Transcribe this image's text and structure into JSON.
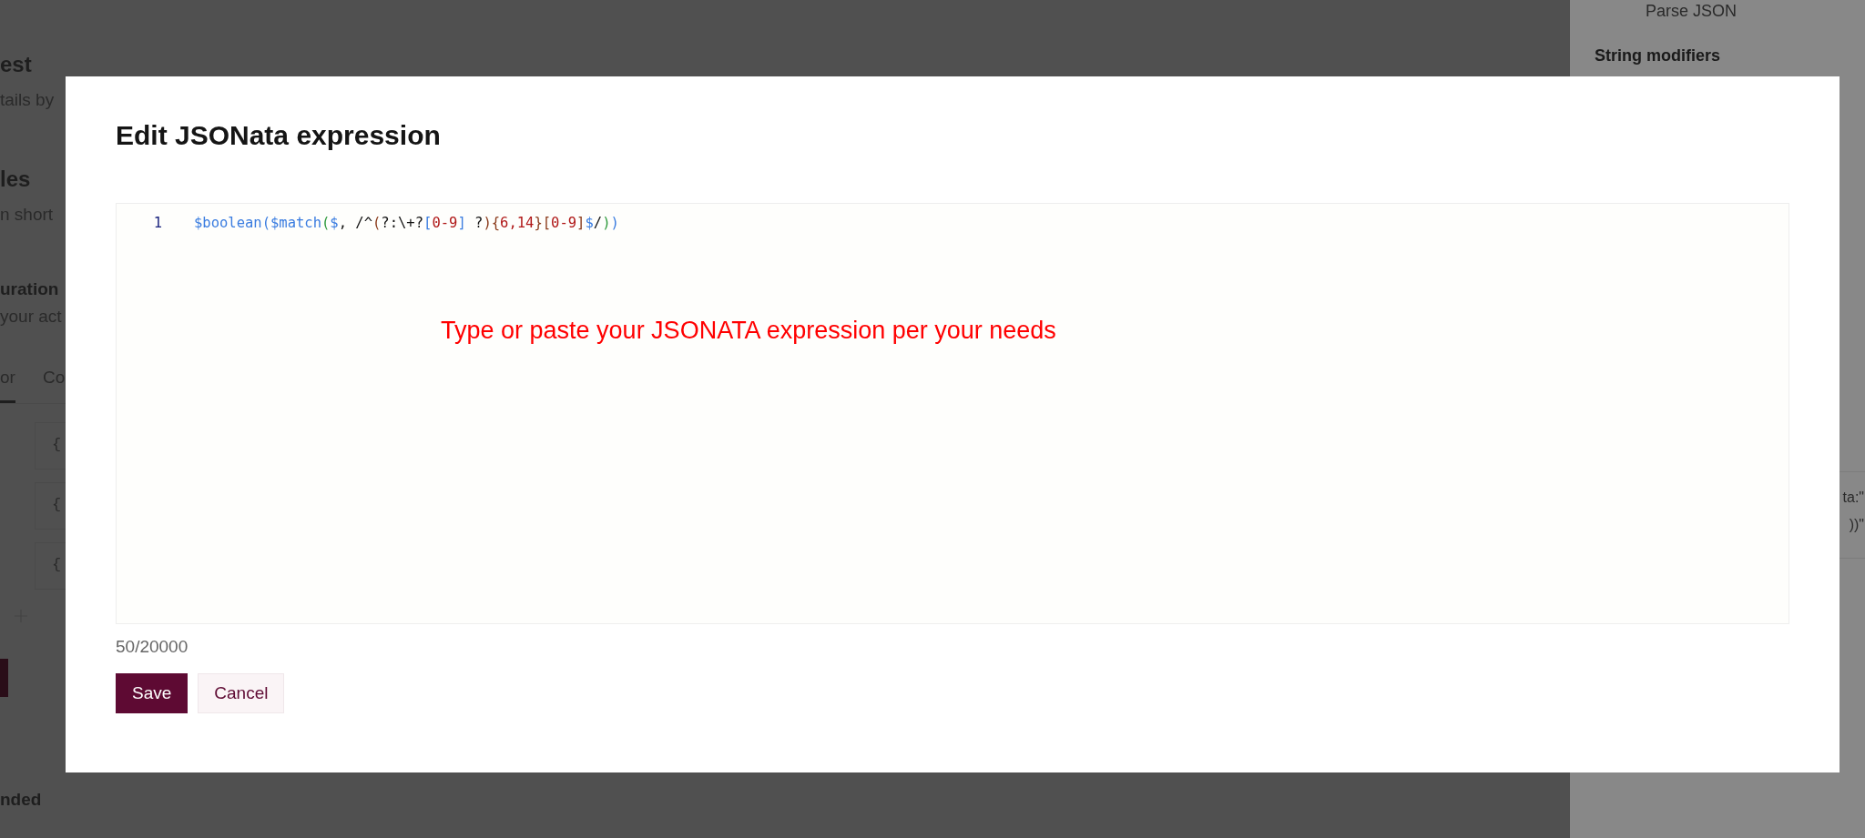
{
  "background": {
    "left": {
      "heading_1": "est",
      "text_1": "tails by",
      "heading_2": "les",
      "text_2": "n short",
      "heading_3": "uration",
      "text_3": "your act",
      "tabs": [
        {
          "label": "or",
          "selected": true
        },
        {
          "label": "Co",
          "selected": false
        }
      ],
      "rows": [
        "{",
        "{",
        "{"
      ],
      "footer_heading": "nded"
    },
    "right": {
      "item": "Parse JSON",
      "section": "String modifiers",
      "code_lines": [
        "ta:\"",
        "))\""
      ]
    }
  },
  "dialog": {
    "title": "Edit JSONata expression",
    "editor": {
      "line_number": "1",
      "tokens": [
        {
          "text": "$boolean(",
          "kind": "function"
        },
        {
          "text": "$match",
          "kind": "function"
        },
        {
          "text": "(",
          "kind": "bracket"
        },
        {
          "text": "$",
          "kind": "function"
        },
        {
          "text": ", /^",
          "kind": "plain"
        },
        {
          "text": "(",
          "kind": "group"
        },
        {
          "text": "?:\\+?",
          "kind": "plain"
        },
        {
          "text": "[",
          "kind": "function"
        },
        {
          "text": "0-9",
          "kind": "number"
        },
        {
          "text": "]",
          "kind": "function"
        },
        {
          "text": " ?",
          "kind": "plain"
        },
        {
          "text": ")",
          "kind": "group"
        },
        {
          "text": "{",
          "kind": "group"
        },
        {
          "text": "6,14",
          "kind": "number"
        },
        {
          "text": "}",
          "kind": "group"
        },
        {
          "text": "[",
          "kind": "group"
        },
        {
          "text": "0-9",
          "kind": "number"
        },
        {
          "text": "]",
          "kind": "group"
        },
        {
          "text": "$",
          "kind": "function"
        },
        {
          "text": "/",
          "kind": "plain"
        },
        {
          "text": ")",
          "kind": "bracket"
        },
        {
          "text": ")",
          "kind": "function"
        }
      ],
      "annotation": "Type or paste your JSONATA expression per your needs"
    },
    "counter": "50/20000",
    "buttons": [
      {
        "label": "Save",
        "kind": "primary"
      },
      {
        "label": "Cancel",
        "kind": "secondary"
      }
    ]
  }
}
